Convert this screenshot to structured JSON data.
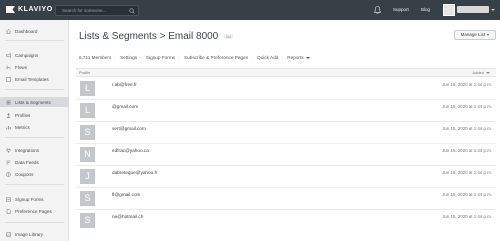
{
  "topbar": {
    "brand": "KLAVIYO",
    "search_placeholder": "Search for someone...",
    "support": "Support",
    "blog": "Blog"
  },
  "sidebar": {
    "items": [
      {
        "label": "Dashboard",
        "icon": "home-icon",
        "active": false
      },
      {
        "label": "Campaigns",
        "icon": "megaphone-icon",
        "active": false
      },
      {
        "label": "Flows",
        "icon": "flow-icon",
        "active": false
      },
      {
        "label": "Email Templates",
        "icon": "template-icon",
        "active": false
      },
      {
        "label": "Lists & Segments",
        "icon": "list-icon",
        "active": true
      },
      {
        "label": "Profiles",
        "icon": "person-icon",
        "active": false
      },
      {
        "label": "Metrics",
        "icon": "chart-icon",
        "active": false
      },
      {
        "label": "Integrations",
        "icon": "plug-icon",
        "active": false
      },
      {
        "label": "Data Feeds",
        "icon": "feed-icon",
        "active": false
      },
      {
        "label": "Coupons",
        "icon": "coupon-icon",
        "active": false
      },
      {
        "label": "Signup Forms",
        "icon": "form-icon",
        "active": false
      },
      {
        "label": "Preference Pages",
        "icon": "page-icon",
        "active": false
      },
      {
        "label": "Image Library",
        "icon": "image-icon",
        "active": false
      }
    ]
  },
  "main": {
    "breadcrumb_root": "Lists & Segments",
    "breadcrumb_sep": ">",
    "list_name": "Email 8000",
    "list_tag": "list",
    "manage_button": "Manage List",
    "members": "6,711 Members",
    "subnav": [
      "Settings",
      "Signup Forms",
      "Subscribe & Preference Pages",
      "Quick Add",
      "Reports"
    ],
    "table": {
      "col_profile": "Profile",
      "col_added": "Added",
      "rows": [
        {
          "initial": "L",
          "email": "r.ab@free.fr",
          "date": "Jun 15, 2020 at 1:44 p.m."
        },
        {
          "initial": "L",
          "email": "@gmail.com",
          "date": "Jun 15, 2020 at 1:44 p.m."
        },
        {
          "initial": "S",
          "email": "sert@gmail.com",
          "date": "Jun 15, 2020 at 1:44 p.m."
        },
        {
          "initial": "N",
          "email": "edfrac@yahoo.ca",
          "date": "Jun 15, 2020 at 1:44 p.m."
        },
        {
          "initial": "J",
          "email": "dabreteque@yahoo.fr",
          "date": "Jun 15, 2020 at 1:44 p.m."
        },
        {
          "initial": "S",
          "email": "fl@gmail.com",
          "date": "Jun 15, 2020 at 1:44 p.m."
        },
        {
          "initial": "S",
          "email": "ne@hotmail.ch",
          "date": "Jun 15, 2020 at 1:44 p.m."
        }
      ]
    }
  },
  "colors": {
    "topbar": "#373f47",
    "sidebar": "#f3f3f3",
    "active_item": "#d7d9dc",
    "avatar": "#c4c7ca"
  }
}
